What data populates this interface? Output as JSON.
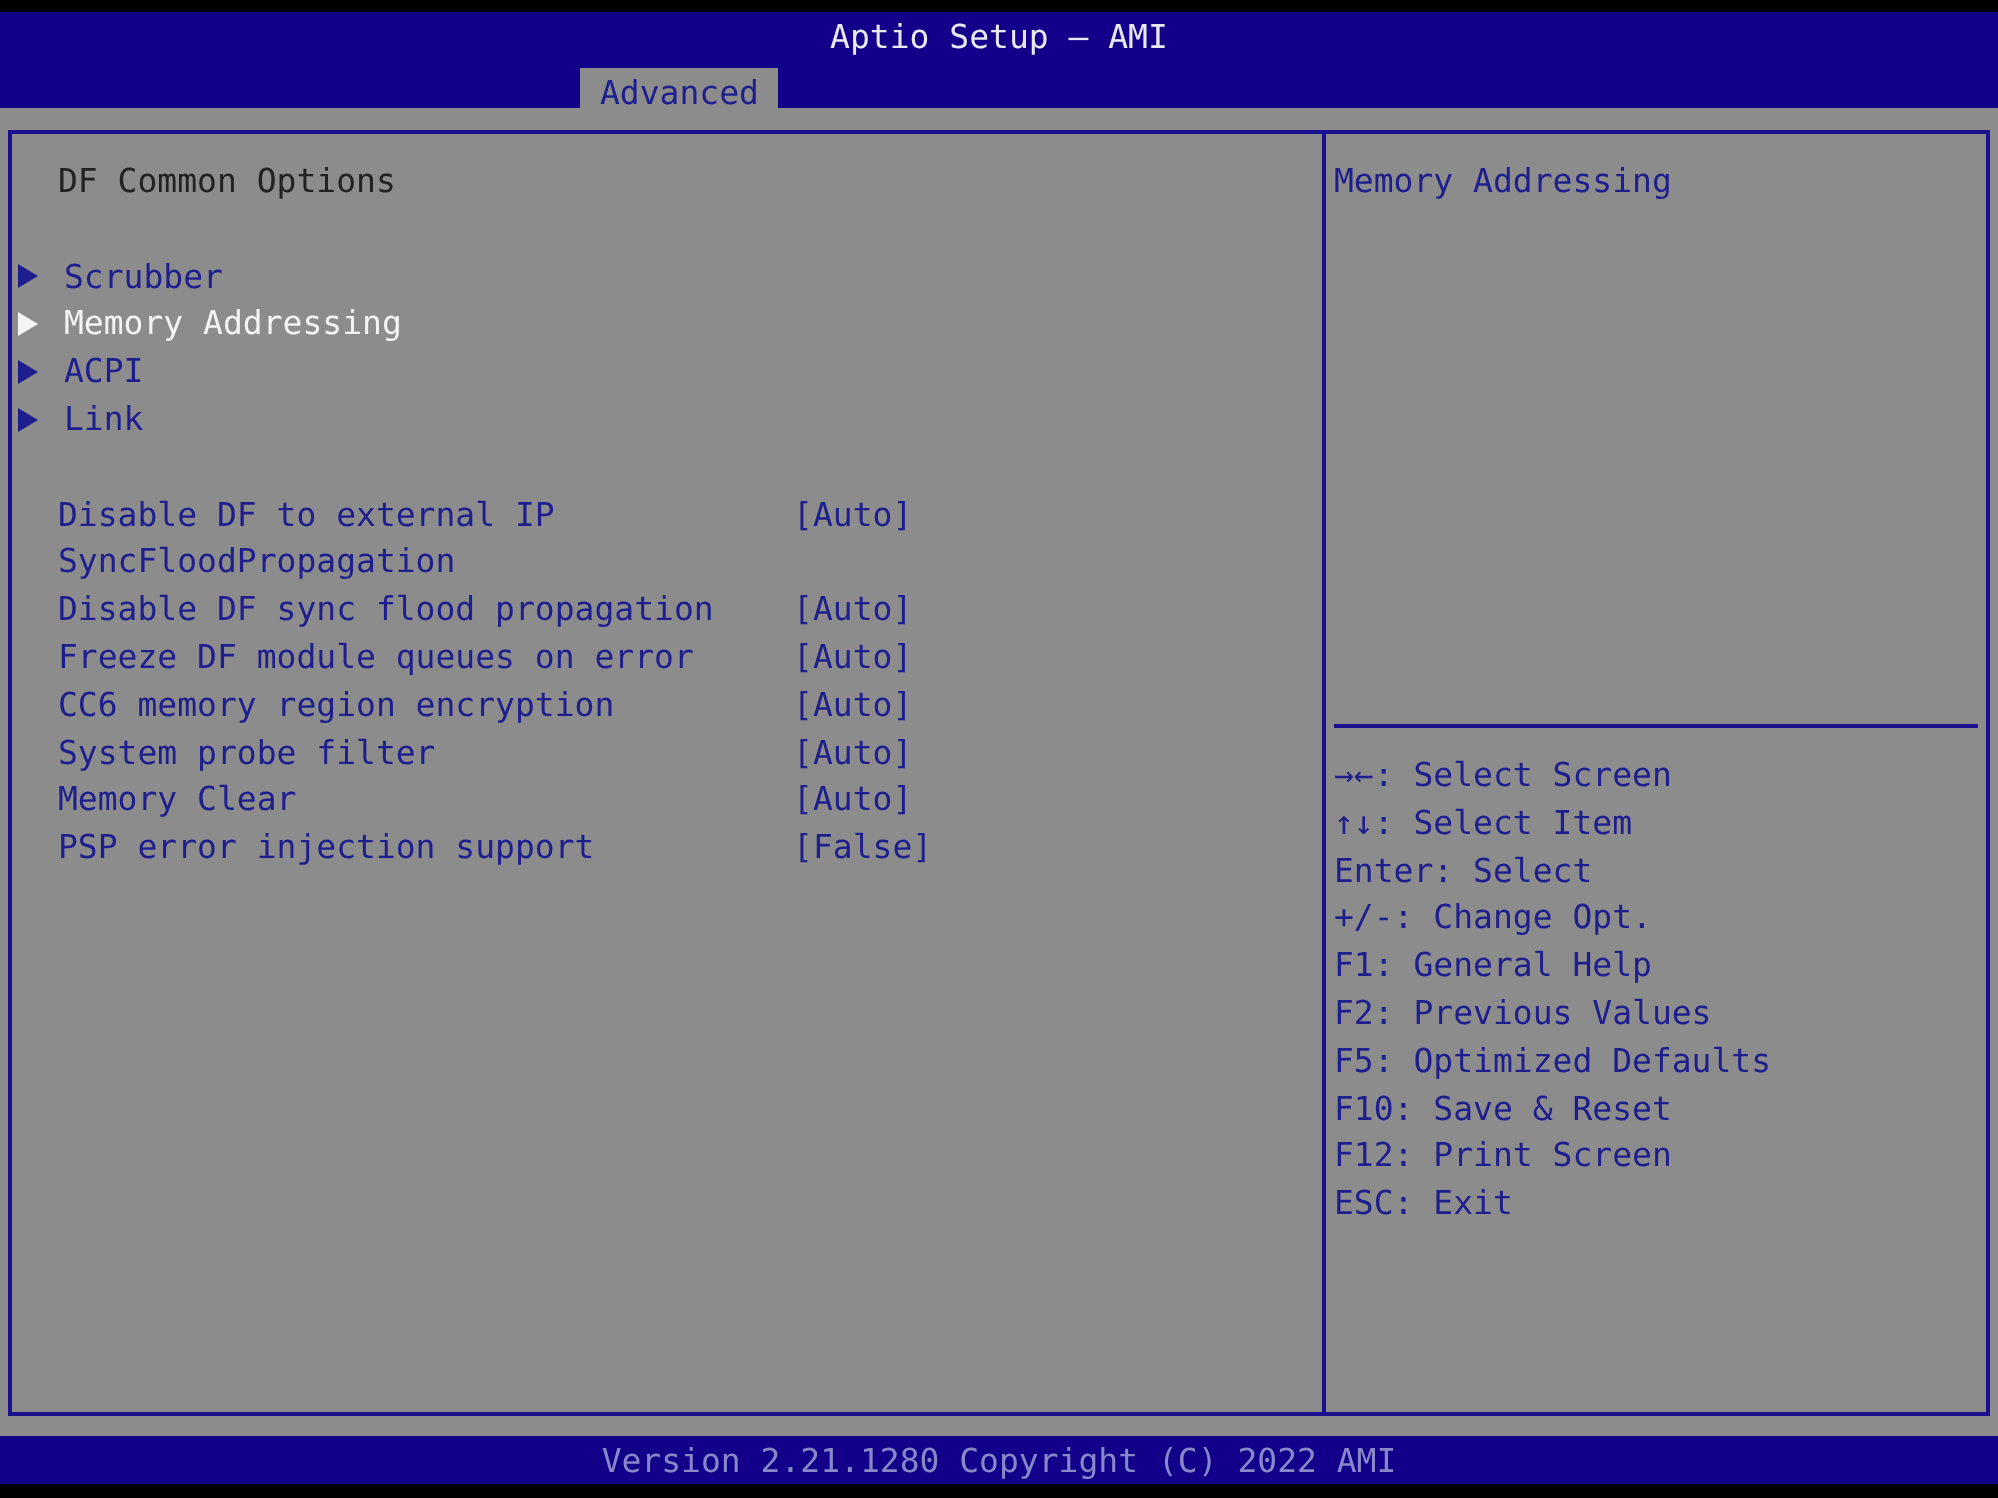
{
  "header": {
    "title": "Aptio Setup – AMI",
    "tabs": [
      {
        "label": "Advanced",
        "selected": true
      }
    ]
  },
  "page": {
    "heading": "DF Common Options",
    "submenus": [
      {
        "label": "Scrubber",
        "selected": false
      },
      {
        "label": "Memory Addressing",
        "selected": true
      },
      {
        "label": "ACPI",
        "selected": false
      },
      {
        "label": "Link",
        "selected": false
      }
    ],
    "settings": [
      {
        "label": "Disable DF to external IP SyncFloodPropagation",
        "value": "[Auto]"
      },
      {
        "label": "Disable DF sync flood propagation",
        "value": "[Auto]"
      },
      {
        "label": "Freeze DF module queues on error",
        "value": "[Auto]"
      },
      {
        "label": "CC6 memory region encryption",
        "value": "[Auto]"
      },
      {
        "label": "System probe filter",
        "value": "[Auto]"
      },
      {
        "label": "Memory Clear",
        "value": "[Auto]"
      },
      {
        "label": "PSP error injection support",
        "value": "[False]"
      }
    ]
  },
  "help": {
    "description": "Memory Addressing",
    "keys": [
      "→←: Select Screen",
      "↑↓: Select Item",
      "Enter: Select",
      "+/-: Change Opt.",
      "F1: General Help",
      "F2: Previous Values",
      "F5: Optimized Defaults",
      "F10: Save & Reset",
      "F12: Print Screen",
      "ESC: Exit"
    ]
  },
  "footer": "Version 2.21.1280 Copyright (C) 2022 AMI"
}
